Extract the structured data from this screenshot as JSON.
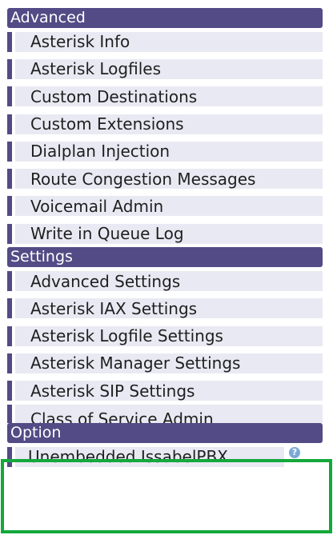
{
  "sections": [
    {
      "title": "Advanced",
      "items": [
        "Asterisk Info",
        "Asterisk Logfiles",
        "Custom Destinations",
        "Custom Extensions",
        "Dialplan Injection",
        "Route Congestion Messages",
        "Voicemail Admin",
        "Write in Queue Log"
      ]
    },
    {
      "title": "Settings",
      "items": [
        "Advanced Settings",
        "Asterisk IAX Settings",
        "Asterisk Logfile Settings",
        "Asterisk Manager Settings",
        "Asterisk SIP Settings",
        "Class of Service Admin"
      ]
    },
    {
      "title": "Option",
      "items": [
        "Unembedded IssabelPBX"
      ]
    }
  ],
  "colors": {
    "header_bg": "#524b85",
    "item_bg": "#e9e9f3",
    "highlight": "#14a83c",
    "help_icon": "#7ba9d6"
  },
  "icons": {
    "help": "question-circle-icon"
  }
}
